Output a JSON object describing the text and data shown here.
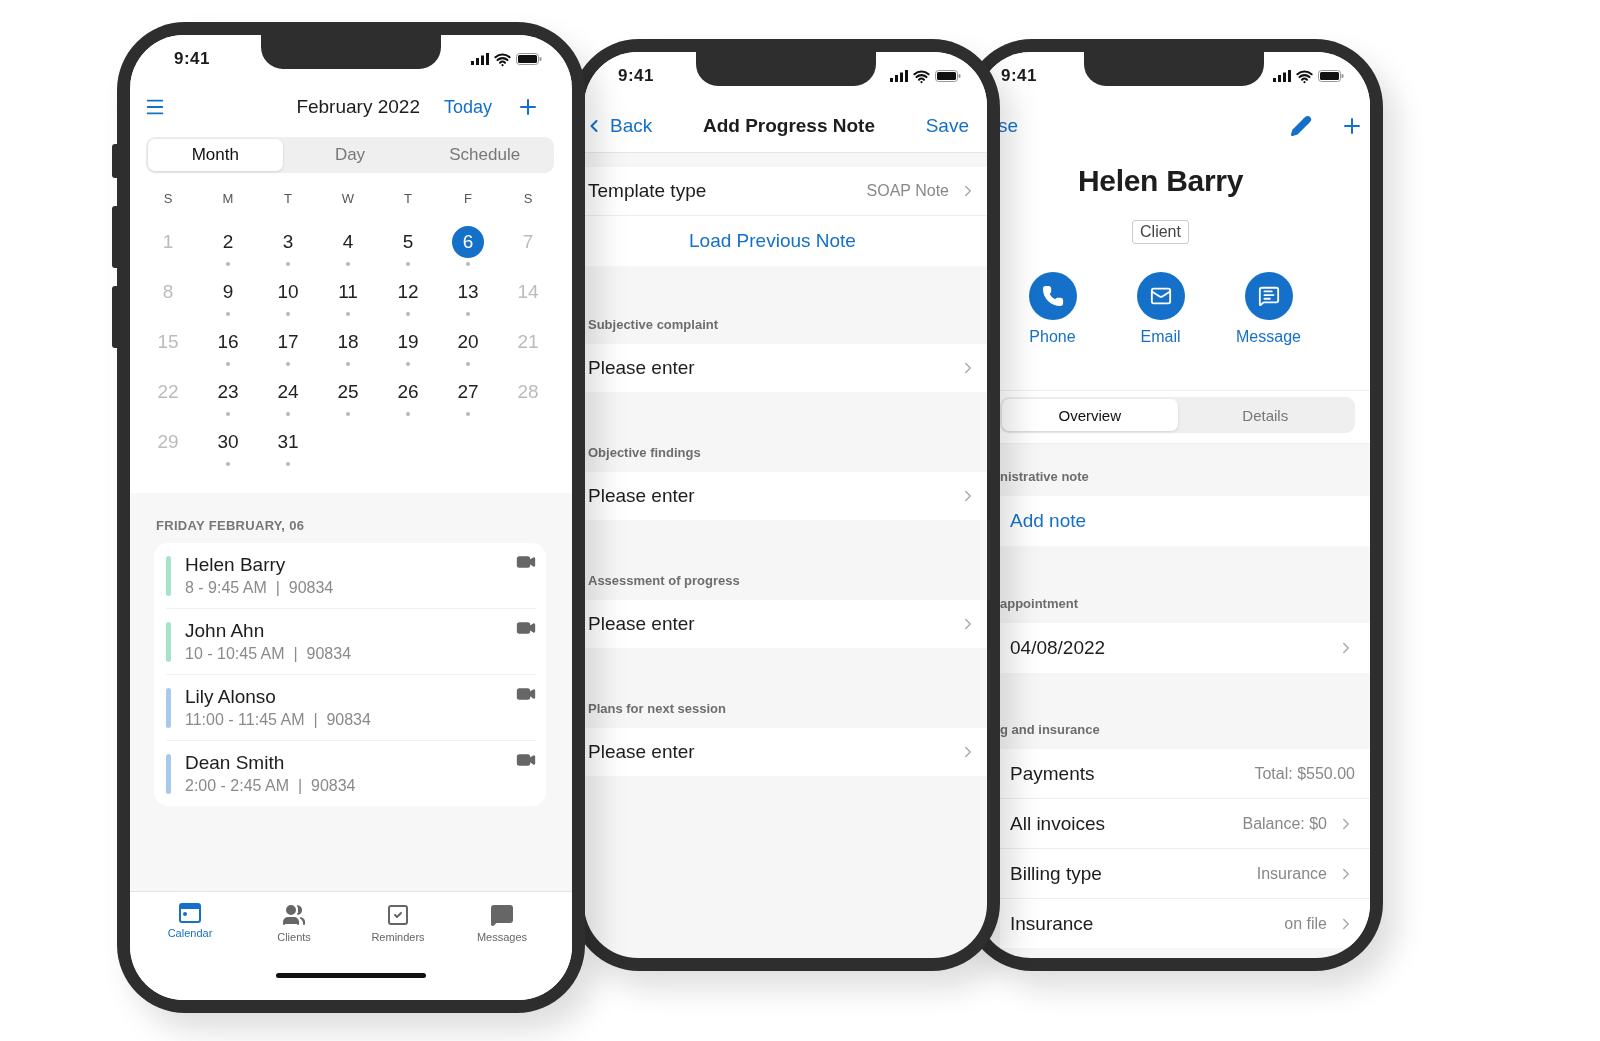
{
  "calendar_screen": {
    "status_time": "9:41",
    "title": "February 2022",
    "today_button": "Today",
    "view_tabs": [
      {
        "label": "Month",
        "selected": true
      },
      {
        "label": "Day",
        "selected": false
      },
      {
        "label": "Schedule",
        "selected": false
      }
    ],
    "weekdays": [
      "S",
      "M",
      "T",
      "W",
      "T",
      "F",
      "S"
    ],
    "days": [
      {
        "label": "1",
        "muted": true,
        "has_events": false,
        "selected": false
      },
      {
        "label": "2",
        "muted": false,
        "has_events": true,
        "selected": false
      },
      {
        "label": "3",
        "muted": false,
        "has_events": true,
        "selected": false
      },
      {
        "label": "4",
        "muted": false,
        "has_events": true,
        "selected": false
      },
      {
        "label": "5",
        "muted": false,
        "has_events": true,
        "selected": false
      },
      {
        "label": "6",
        "muted": false,
        "has_events": true,
        "selected": true
      },
      {
        "label": "7",
        "muted": true,
        "has_events": false,
        "selected": false
      },
      {
        "label": "8",
        "muted": true,
        "has_events": false,
        "selected": false
      },
      {
        "label": "9",
        "muted": false,
        "has_events": true,
        "selected": false
      },
      {
        "label": "10",
        "muted": false,
        "has_events": true,
        "selected": false
      },
      {
        "label": "11",
        "muted": false,
        "has_events": true,
        "selected": false
      },
      {
        "label": "12",
        "muted": false,
        "has_events": true,
        "selected": false
      },
      {
        "label": "13",
        "muted": false,
        "has_events": true,
        "selected": false
      },
      {
        "label": "14",
        "muted": true,
        "has_events": false,
        "selected": false
      },
      {
        "label": "15",
        "muted": true,
        "has_events": false,
        "selected": false
      },
      {
        "label": "16",
        "muted": false,
        "has_events": true,
        "selected": false
      },
      {
        "label": "17",
        "muted": false,
        "has_events": true,
        "selected": false
      },
      {
        "label": "18",
        "muted": false,
        "has_events": true,
        "selected": false
      },
      {
        "label": "19",
        "muted": false,
        "has_events": true,
        "selected": false
      },
      {
        "label": "20",
        "muted": false,
        "has_events": true,
        "selected": false
      },
      {
        "label": "21",
        "muted": true,
        "has_events": false,
        "selected": false
      },
      {
        "label": "22",
        "muted": true,
        "has_events": false,
        "selected": false
      },
      {
        "label": "23",
        "muted": false,
        "has_events": true,
        "selected": false
      },
      {
        "label": "24",
        "muted": false,
        "has_events": true,
        "selected": false
      },
      {
        "label": "25",
        "muted": false,
        "has_events": true,
        "selected": false
      },
      {
        "label": "26",
        "muted": false,
        "has_events": true,
        "selected": false
      },
      {
        "label": "27",
        "muted": false,
        "has_events": true,
        "selected": false
      },
      {
        "label": "28",
        "muted": true,
        "has_events": false,
        "selected": false
      },
      {
        "label": "29",
        "muted": true,
        "has_events": false,
        "selected": false
      },
      {
        "label": "30",
        "muted": false,
        "has_events": true,
        "selected": false
      },
      {
        "label": "31",
        "muted": false,
        "has_events": true,
        "selected": false
      }
    ],
    "agenda_date": "FRIDAY FEBRUARY, 06",
    "appointments": [
      {
        "name": "Helen Barry",
        "time": "8 - 9:45 AM  |  90834",
        "color": "#a6e3c8"
      },
      {
        "name": "John Ahn",
        "time": "10 - 10:45 AM  |  90834",
        "color": "#a6e3c8"
      },
      {
        "name": "Lily Alonso",
        "time": "11:00 - 11:45 AM  |  90834",
        "color": "#a9c9ec"
      },
      {
        "name": "Dean Smith",
        "time": "2:00 - 2:45 AM  |  90834",
        "color": "#a9c9ec"
      }
    ],
    "tab_bar": [
      {
        "kind": "calendar",
        "label": "Calendar",
        "selected": true
      },
      {
        "kind": "clients",
        "label": "Clients",
        "selected": false
      },
      {
        "kind": "reminders",
        "label": "Reminders",
        "selected": false
      },
      {
        "kind": "messages",
        "label": "Messages",
        "selected": false
      }
    ]
  },
  "note_screen": {
    "status_time": "9:41",
    "back_button": "Back",
    "title": "Add Progress Note",
    "save_button": "Save",
    "template": {
      "label": "Template type",
      "value": "SOAP Note"
    },
    "load_button": "Load Previous Note",
    "sections": [
      {
        "heading": "Subjective complaint",
        "prompt": "Please enter"
      },
      {
        "heading": "Objective findings",
        "prompt": "Please enter"
      },
      {
        "heading": "Assessment of progress",
        "prompt": "Please enter"
      },
      {
        "heading": "Plans for next session",
        "prompt": "Please enter"
      }
    ]
  },
  "client_screen": {
    "status_time": "9:41",
    "back_button": "se",
    "name": "Helen Barry",
    "role": "Client",
    "actions": [
      {
        "kind": "phone",
        "label": "Phone"
      },
      {
        "kind": "email",
        "label": "Email"
      },
      {
        "kind": "message",
        "label": "Message"
      }
    ],
    "segments": [
      {
        "label": "Overview",
        "selected": true
      },
      {
        "label": "Details",
        "selected": false
      }
    ],
    "admin_note": {
      "heading": "nistrative note",
      "action": "Add note"
    },
    "appointment": {
      "heading": "appointment",
      "value": "04/08/2022"
    },
    "billing": {
      "heading": "g and insurance",
      "rows": [
        {
          "label": "Payments",
          "value": "Total: $550.00",
          "chevron": false
        },
        {
          "label": "All invoices",
          "value": "Balance: $0",
          "chevron": true
        },
        {
          "label": "Billing type",
          "value": "Insurance",
          "chevron": true
        },
        {
          "label": "Insurance",
          "value": "on file",
          "chevron": true
        }
      ]
    }
  }
}
